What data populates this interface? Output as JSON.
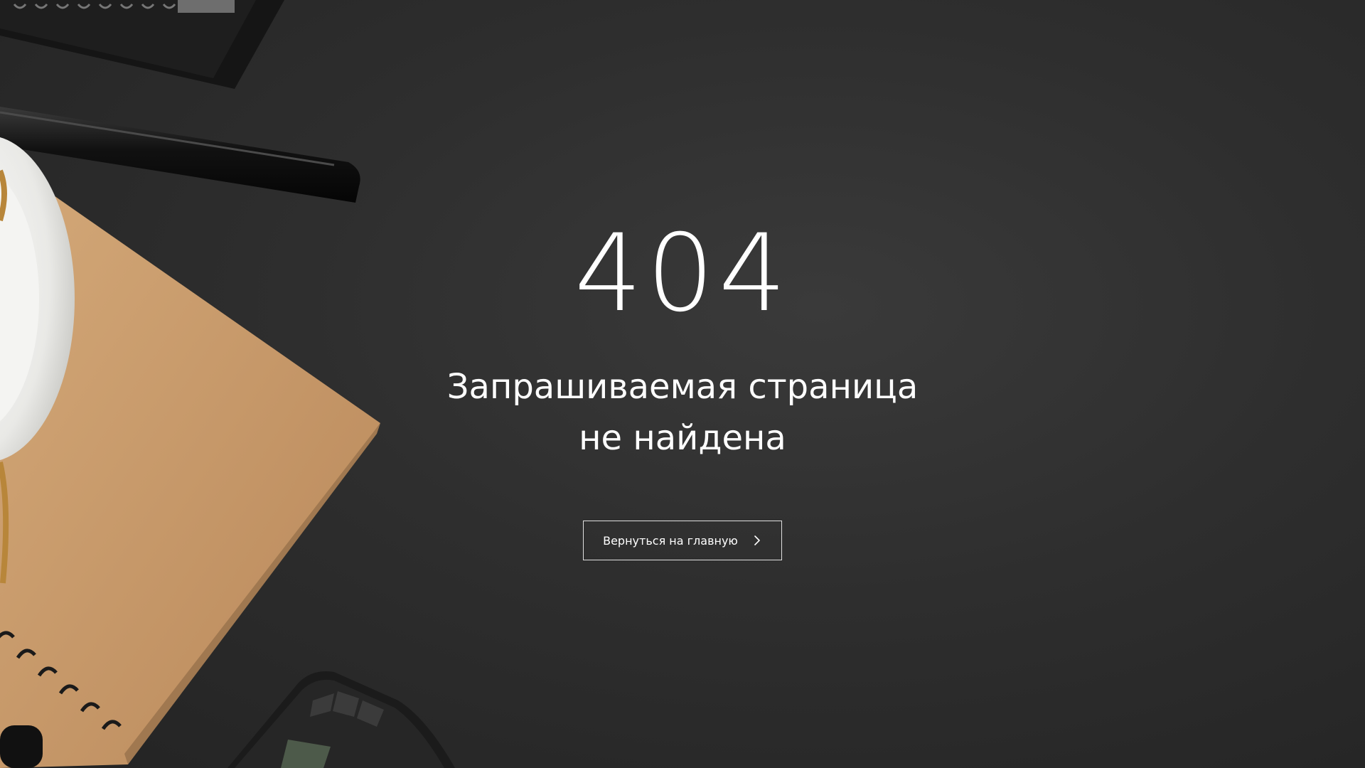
{
  "error": {
    "code": "404",
    "message_line1": "Запрашиваемая страница",
    "message_line2": "не найдена"
  },
  "actions": {
    "home_label": "Вернуться на главную",
    "home_icon": "chevron-right-icon"
  },
  "colors": {
    "background": "#2d2d2d",
    "text": "#ffffff",
    "notebook": "#c79a6b",
    "saucer": "#efefed"
  }
}
